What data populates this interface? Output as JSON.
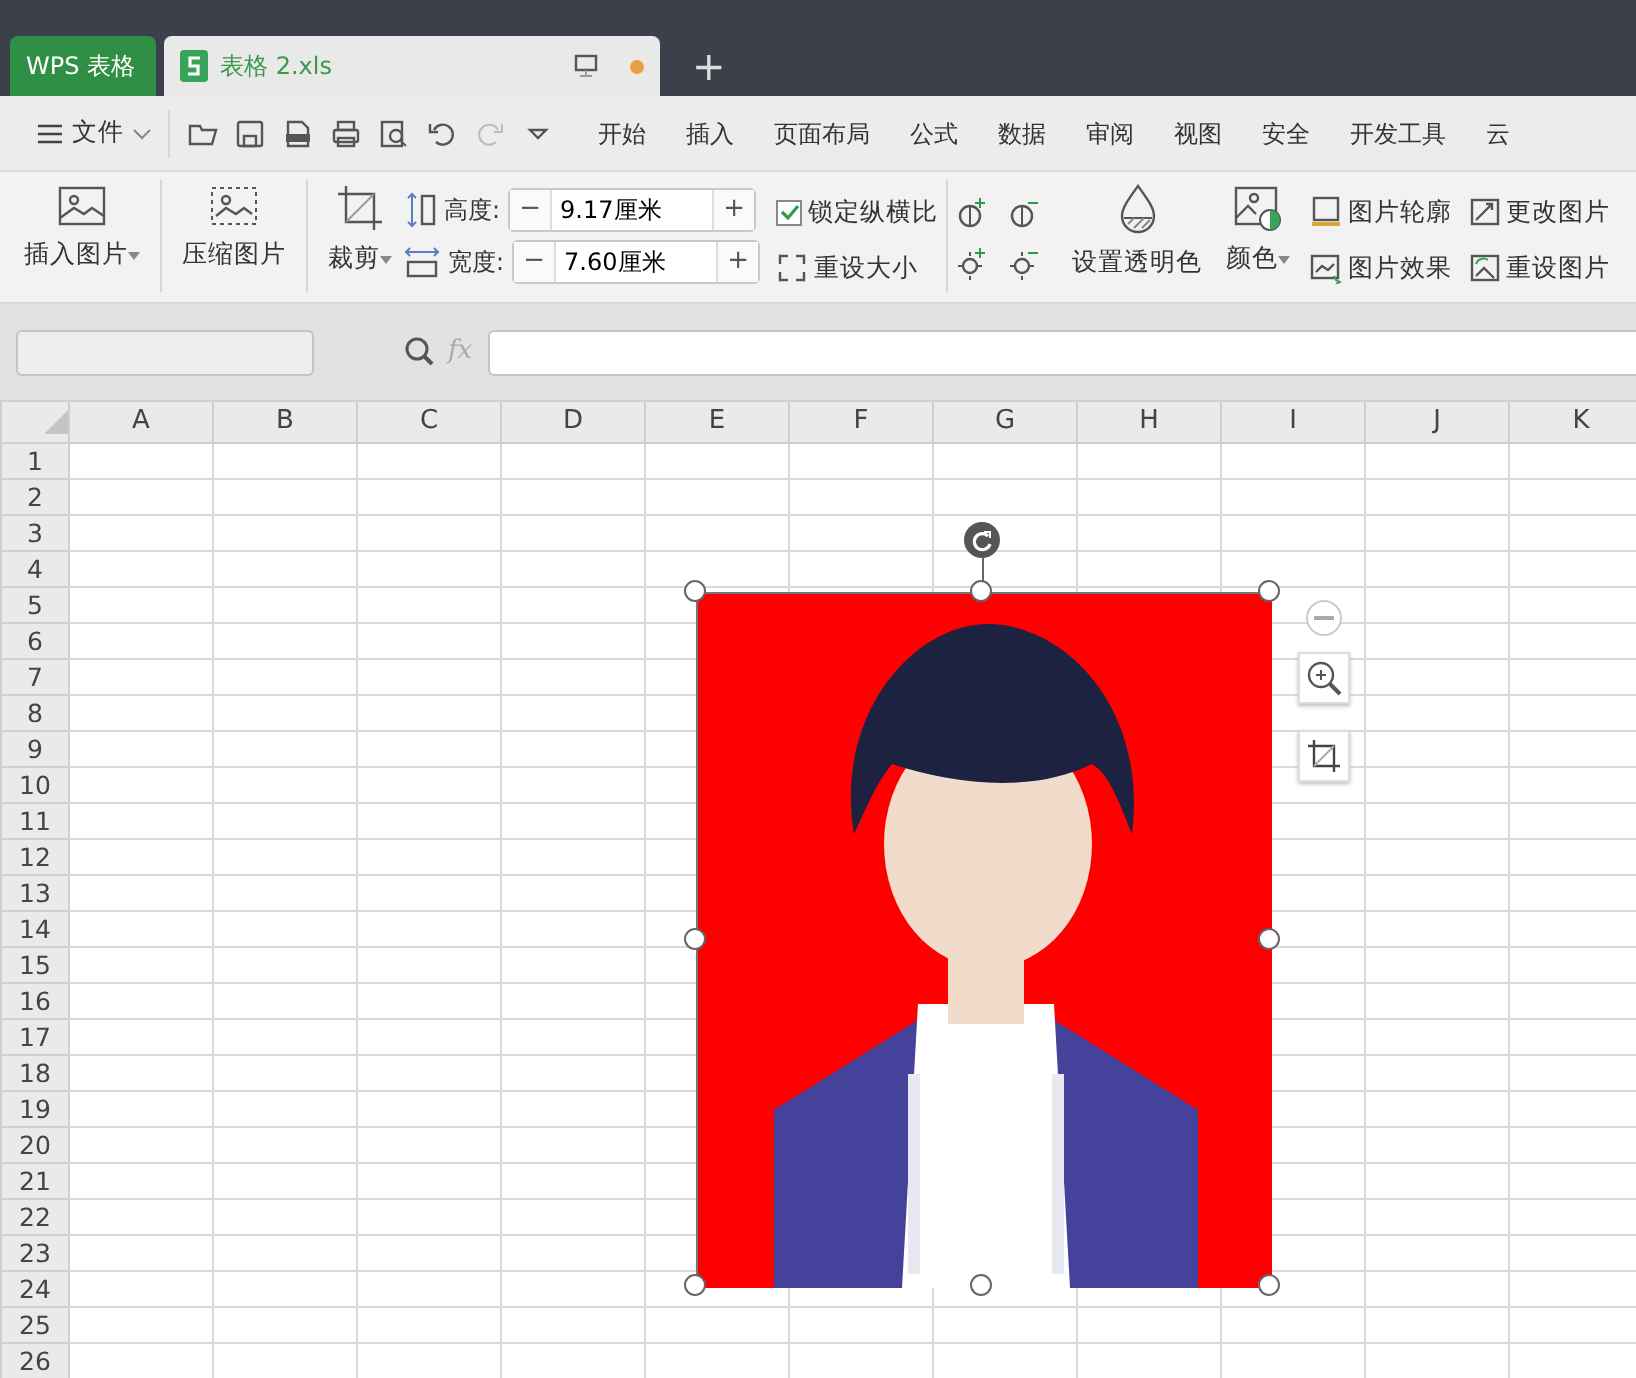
{
  "tabs": [
    {
      "label": "WPS 表格",
      "kind": "home",
      "selected": false
    },
    {
      "label": "表格 2.xls",
      "kind": "doc",
      "selected": true
    }
  ],
  "tab_add": "+",
  "menu": {
    "file": "文件",
    "tabs": [
      "开始",
      "插入",
      "页面布局",
      "公式",
      "数据",
      "审阅",
      "视图",
      "安全",
      "开发工具",
      "云"
    ]
  },
  "ribbon": {
    "insert_picture": "插入图片",
    "compress": "压缩图片",
    "crop": "裁剪",
    "height_label": "高度:",
    "height_value": "9.17厘米",
    "width_label": "宽度:",
    "width_value": "7.60厘米",
    "spin_minus": "−",
    "spin_plus": "+",
    "lock_ratio": {
      "label": "锁定纵横比",
      "checked": true
    },
    "reset_size": "重设大小",
    "transparent": "设置透明色",
    "color_label": "颜色",
    "outline": "图片轮廓",
    "effect": "图片效果",
    "change": "更改图片",
    "reset_picture": "重设图片"
  },
  "formula_bar": {
    "fx": "fx"
  },
  "columns": [
    "A",
    "B",
    "C",
    "D",
    "E",
    "F",
    "G",
    "H",
    "I",
    "J",
    "K"
  ],
  "rows": [
    "1",
    "2",
    "3",
    "4",
    "5",
    "6",
    "7",
    "8",
    "9",
    "10",
    "11",
    "12",
    "13",
    "14",
    "15",
    "16",
    "17",
    "18",
    "19",
    "20",
    "21",
    "22",
    "23",
    "24",
    "25",
    "26"
  ],
  "image": {
    "kind": "picture",
    "selected": true
  }
}
